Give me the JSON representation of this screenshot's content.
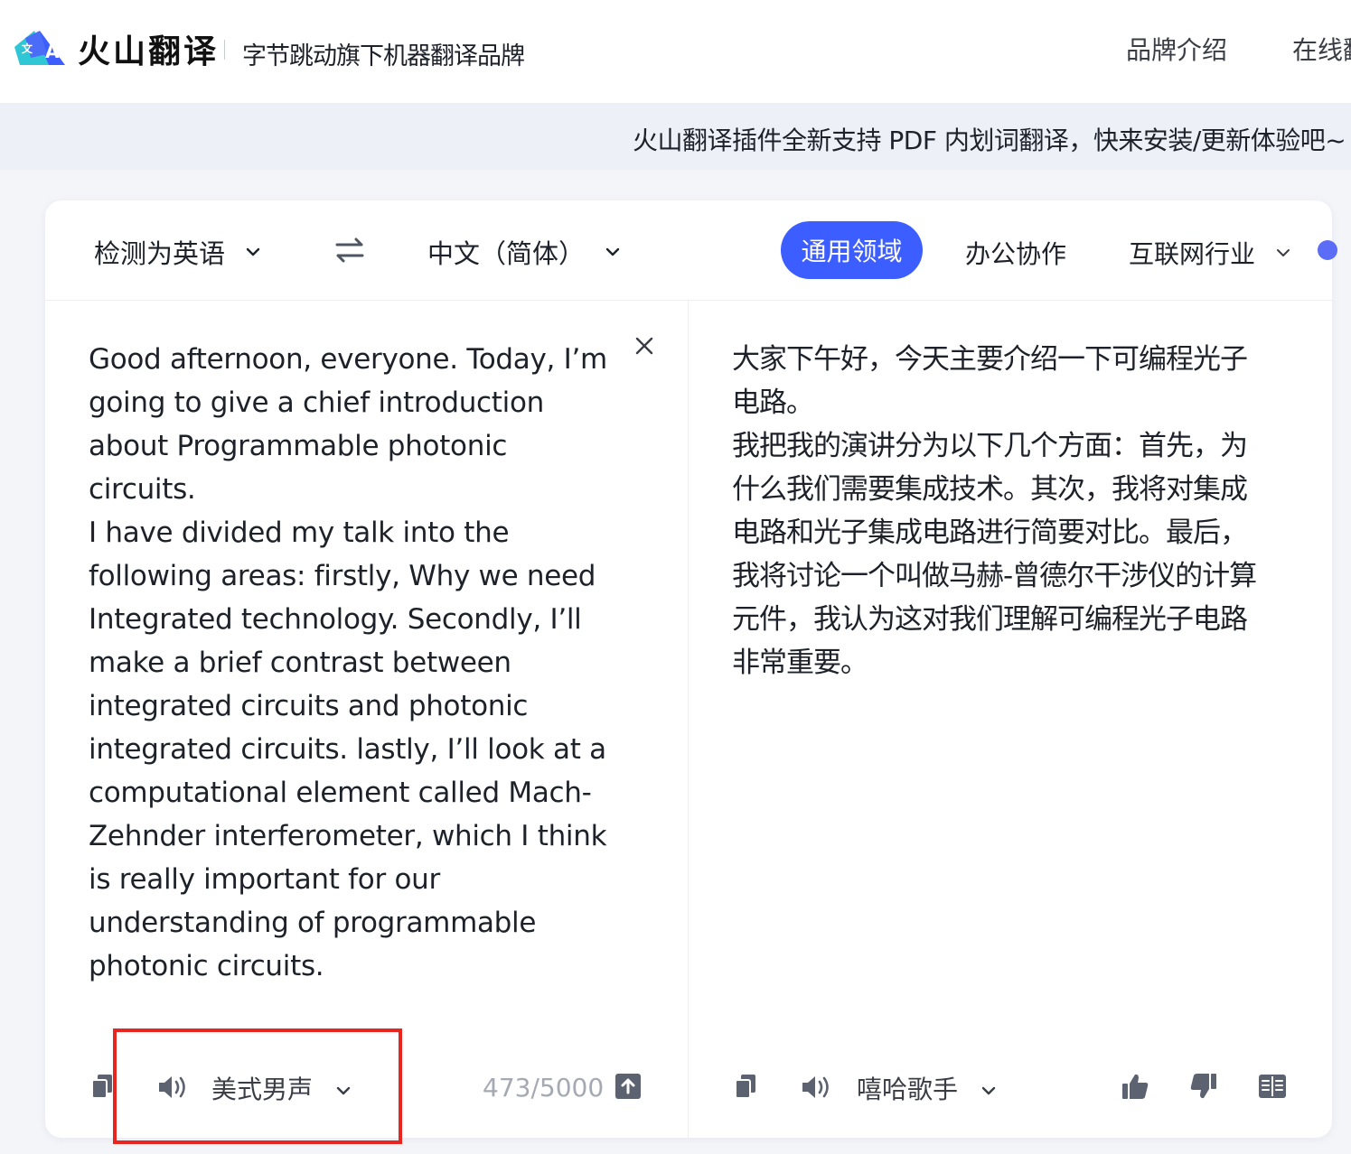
{
  "header": {
    "brand_name": "火山翻译",
    "slogan": "字节跳动旗下机器翻译品牌",
    "nav": [
      "品牌介绍",
      "在线翻"
    ]
  },
  "announcement": "火山翻译插件全新支持 PDF 内划词翻译，快来安装/更新体验吧~",
  "toolbar": {
    "source_lang": "检测为英语",
    "target_lang": "中文（简体）",
    "domains": [
      "通用领域",
      "办公协作",
      "互联网行业"
    ],
    "active_domain": "通用领域"
  },
  "source": {
    "paragraphs": [
      "Good afternoon, everyone. Today, I’m going to give a chief introduction about Programmable photonic circuits.",
      "I have divided my talk into the following areas: firstly, Why we need Integrated technology. Secondly, I’ll make a brief contrast between integrated circuits and photonic integrated circuits. lastly, I’ll look at a computational element called Mach-Zehnder interferometer, which I think is really important for our understanding of programmable photonic circuits."
    ],
    "voice": "美式男声",
    "char_count": "473/5000"
  },
  "target": {
    "paragraphs": [
      "大家下午好，今天主要介绍一下可编程光子电路。",
      "我把我的演讲分为以下几个方面：首先，为什么我们需要集成技术。其次，我将对集成电路和光子集成电路进行简要对比。最后，我将讨论一个叫做马赫-曾德尔干涉仪的计算元件，我认为这对我们理解可编程光子电路非常重要。"
    ],
    "voice": "嘻哈歌手"
  },
  "colors": {
    "accent": "#3c5dff",
    "highlight_border": "#e8251f",
    "icon_gray": "#5c6270"
  },
  "icons": [
    "logo-icon",
    "chevron-down-icon",
    "swap-icon",
    "close-icon",
    "copy-icon",
    "speaker-icon",
    "upload-icon",
    "thumbs-up-icon",
    "thumbs-down-icon",
    "book-icon"
  ]
}
